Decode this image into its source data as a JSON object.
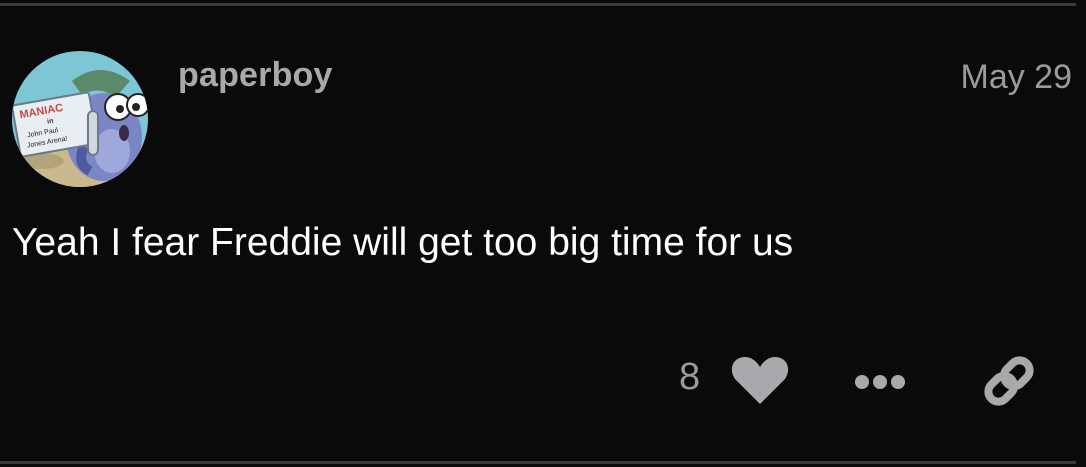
{
  "post": {
    "username": "paperboy",
    "date": "May 29",
    "body": "Yeah I fear Freddie will get too big time for us",
    "like_count": "8"
  },
  "avatar": {
    "sign_text_1": "MANIAC",
    "sign_text_2": "in",
    "sign_text_3": "John Paul",
    "sign_text_4": "Jones Arena!"
  },
  "icons": {
    "like": "heart-icon",
    "more": "ellipsis-icon",
    "link": "link-icon"
  },
  "colors": {
    "background": "#0a0a0b",
    "divider": "#3a3a3c",
    "muted_text": "#9a9a9c",
    "icon": "#a9a9ab"
  }
}
